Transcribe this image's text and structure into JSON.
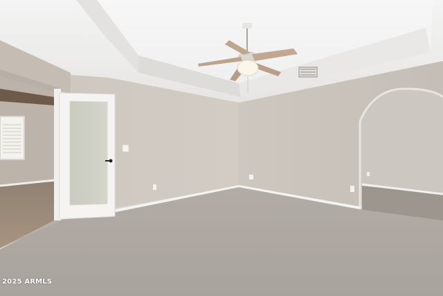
{
  "watermark": "2025 ARMLS"
}
